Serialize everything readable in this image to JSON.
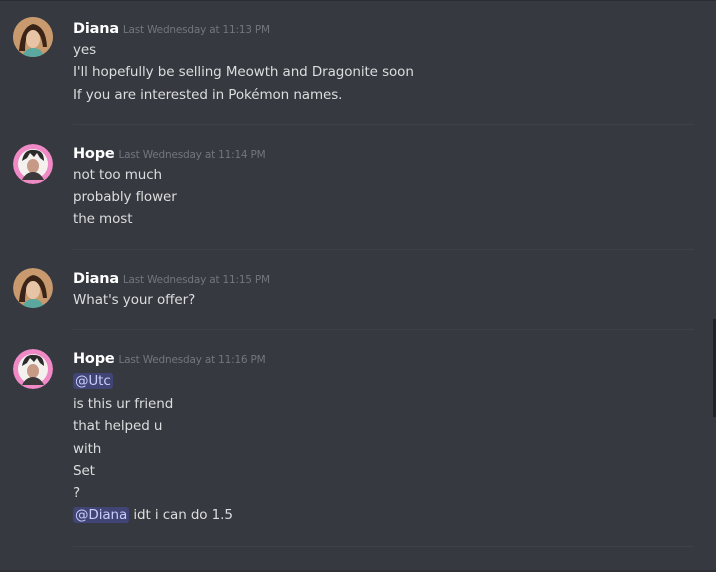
{
  "messages": [
    {
      "author": "Diana",
      "timestamp": "Last Wednesday at 11:13 PM",
      "lines": [
        "yes",
        "I'll hopefully be selling Meowth and Dragonite soon",
        "If you are interested in Pokémon names."
      ]
    },
    {
      "author": "Hope",
      "timestamp": "Last Wednesday at 11:14 PM",
      "lines": [
        "not too much",
        "probably flower",
        "the most"
      ]
    },
    {
      "author": "Diana",
      "timestamp": "Last Wednesday at 11:15 PM",
      "lines": [
        "What's your offer?"
      ]
    },
    {
      "author": "Hope",
      "timestamp": "Last Wednesday at 11:16 PM",
      "mention1": "@Utc",
      "lines": [
        "is this ur friend",
        "that helped u",
        "with",
        "Set",
        "?"
      ],
      "mention2": "@Diana",
      "last_line_text": " idt i can do 1.5"
    }
  ],
  "colors": {
    "background": "#36393f",
    "author": "#ffffff",
    "message_text": "#dcddde",
    "timestamp": "#72767d",
    "mention": "#c9cdfb"
  }
}
